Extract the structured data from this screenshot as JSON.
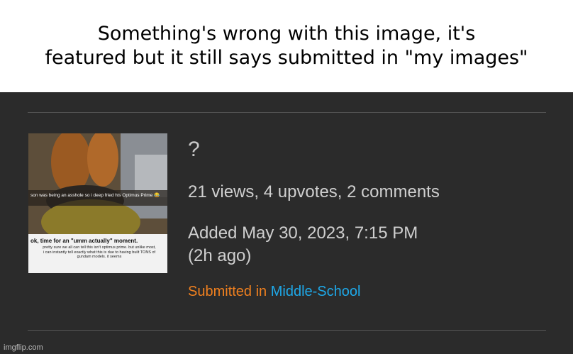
{
  "caption": {
    "line1": "Something's wrong with this image, it's",
    "line2": "featured but it still says submitted in \"my images\""
  },
  "post": {
    "title": "?",
    "stats": "21 views, 4 upvotes, 2 comments",
    "added_line1": "Added May 30, 2023, 7:15 PM",
    "added_line2": "(2h ago)",
    "submitted_prefix": "Submitted in",
    "stream": "Middle-School"
  },
  "thumbnail": {
    "overlay_text": "son was being an asshole so i deep fried his Optimus Prime 😂",
    "heading": "ok, time for an \"umm actually\" moment.",
    "body": "pretty sure we all can tell this isn't optimus prime. but unlike most, i can instantly tell exactly what this is due to having built TONS of gundam models. it seems"
  },
  "watermark": "imgflip.com",
  "colors": {
    "panel_bg": "#2b2b2b",
    "submitted_color": "#f0801f",
    "stream_link_color": "#1ea8e8"
  }
}
